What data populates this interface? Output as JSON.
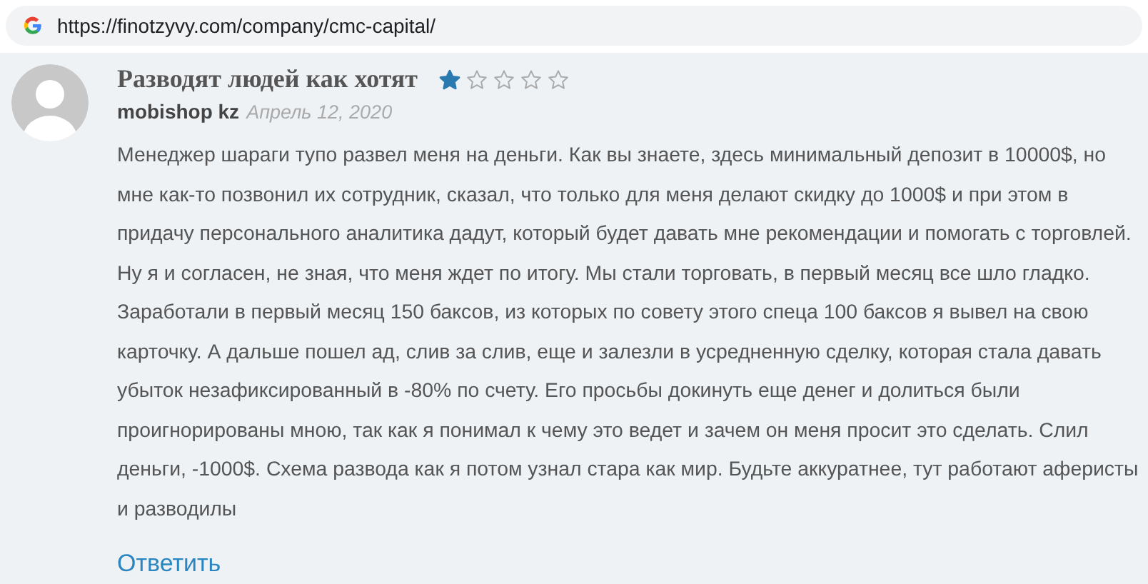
{
  "address_bar": {
    "url": "https://finotzyvy.com/company/cmc-capital/"
  },
  "review": {
    "title": "Разводят людей как хотят",
    "stars": 1,
    "author": "mobishop kz",
    "date": "Апрель 12, 2020",
    "text": "Менеджер шараги тупо развел меня на деньги. Как вы знаете, здесь минимальный депозит в 10000$, но мне как-то позвонил их сотрудник, сказал, что только для меня делают скидку до 1000$ и при этом в придачу персонального аналитика дадут, который будет давать мне рекомендации и помогать с торговлей. Ну я и согласен, не зная, что меня ждет по итогу. Мы стали торговать, в первый месяц все шло гладко. Заработали в первый месяц 150 баксов, из которых по совету этого спеца 100 баксов я вывел на свою карточку. А дальше пошел ад, слив за слив, еще и залезли в усредненную сделку, которая стала давать убыток незафиксированный в -80% по счету. Его просьбы докинуть еще денег и долиться были проигнорированы мною, так как я понимал к чему это ведет и зачем он меня просит это сделать. Слил деньги, -1000$. Схема развода как я потом узнал стара как мир. Будьте аккуратнее, тут работают аферисты и разводилы",
    "reply": "Ответить"
  }
}
